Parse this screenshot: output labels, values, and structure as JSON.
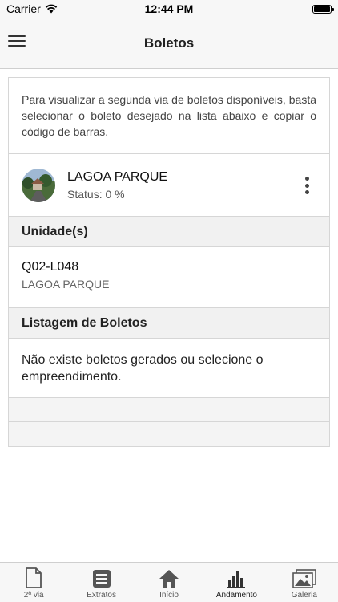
{
  "status_bar": {
    "carrier": "Carrier",
    "time": "12:44 PM"
  },
  "nav": {
    "title": "Boletos"
  },
  "intro": {
    "text": "Para visualizar a segunda via de boletos disponíveis, basta selecionar o boleto desejado na lista abaixo e copiar o código de barras."
  },
  "project": {
    "name": "LAGOA PARQUE",
    "status": "Status: 0 %"
  },
  "units": {
    "header": "Unidade(s)",
    "items": [
      {
        "code": "Q02-L048",
        "project": "LAGOA PARQUE"
      }
    ]
  },
  "boletos": {
    "header": "Listagem de Boletos",
    "empty_message": "Não existe boletos gerados ou selecione o empreendimento."
  },
  "tabs": [
    {
      "label": "2ª via",
      "icon": "document-icon"
    },
    {
      "label": "Extratos",
      "icon": "list-icon"
    },
    {
      "label": "Início",
      "icon": "home-icon"
    },
    {
      "label": "Andamento",
      "icon": "bar-chart-icon"
    },
    {
      "label": "Galeria",
      "icon": "gallery-icon"
    }
  ],
  "colors": {
    "tab_icon": "#555555",
    "background": "#ffffff",
    "section_bg": "#f1f1f1"
  }
}
